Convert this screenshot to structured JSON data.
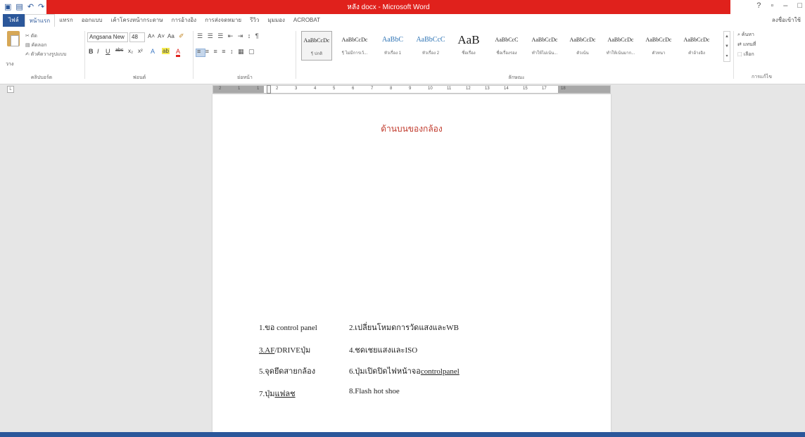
{
  "window": {
    "title": "หลัง docx - Microsoft Word",
    "controls": [
      "?",
      "▫",
      "–",
      "□"
    ]
  },
  "quick_access": [
    "▣",
    "▤",
    "↶",
    "↷"
  ],
  "tabs": [
    {
      "label": "ไฟล์",
      "kind": "file"
    },
    {
      "label": "หน้าแรก",
      "kind": "active"
    },
    {
      "label": "แทรก"
    },
    {
      "label": "ออกแบบ"
    },
    {
      "label": "เค้าโครงหน้ากระดาษ"
    },
    {
      "label": "การอ้างอิง"
    },
    {
      "label": "การส่งจดหมาย"
    },
    {
      "label": "รีวิว"
    },
    {
      "label": "มุมมอง"
    },
    {
      "label": "ACROBAT"
    }
  ],
  "account": "ลงชื่อเข้าใช้",
  "ribbon": {
    "clipboard": {
      "paste_label": "วาง",
      "cut": "✂ ตัด",
      "copy": "▤ คัดลอก",
      "format_painter": "✍ ตัวคัดวางรูปแบบ",
      "label": "คลิปบอร์ด"
    },
    "font": {
      "name": "Angsana New",
      "size": "48",
      "grow": "A˄",
      "shrink": "A˅",
      "case": "Aa",
      "clear": "✐",
      "bold": "B",
      "italic": "I",
      "underline": "U",
      "strike": "abc",
      "sub": "x₂",
      "sup": "x²",
      "effects": "A",
      "highlight": "ab",
      "color": "A",
      "label": "ฟอนต์"
    },
    "paragraph": {
      "row1": "☰ ☰ ☰ ⇤ ⇥ ↕ ¶",
      "row2": "≡ ≡ ≡ ≡ ↕ ▦ ▢",
      "label": "ย่อหน้า"
    },
    "styles": {
      "label": "ลักษณะ",
      "items": [
        {
          "sample": "AaBbCcDc",
          "name": "¶ ปกติ",
          "selected": true
        },
        {
          "sample": "AaBbCcDc",
          "name": "¶ ไม่มีการเว้..."
        },
        {
          "sample": "AaBbC",
          "name": "หัวเรื่อง 1"
        },
        {
          "sample": "AaBbCcC",
          "name": "หัวเรื่อง 2"
        },
        {
          "sample": "AaB",
          "name": "ชื่อเรื่อง"
        },
        {
          "sample": "AaBbCcC",
          "name": "ชื่อเรื่องรอง"
        },
        {
          "sample": "AaBbCcDc",
          "name": "ทำให้ไม่เน้น..."
        },
        {
          "sample": "AaBbCcDc",
          "name": "ตัวเน้น"
        },
        {
          "sample": "AaBbCcDc",
          "name": "ทำให้เน้นมาก..."
        },
        {
          "sample": "AaBbCcDc",
          "name": "ตัวหนา"
        },
        {
          "sample": "AaBbCcDc",
          "name": "คำอ้างอิง"
        }
      ]
    },
    "editing": {
      "find": "ค้นหา",
      "replace": "แทนที่",
      "select": "เลือก",
      "label": "การแก้ไข"
    }
  },
  "ruler": {
    "ticks": [
      "2",
      "1",
      "1",
      "2",
      "3",
      "4",
      "5",
      "6",
      "7",
      "8",
      "9",
      "10",
      "11",
      "12",
      "13",
      "14",
      "15",
      "17",
      "18"
    ]
  },
  "document": {
    "heading": "ด้านบนของกล้อง",
    "labels": [
      {
        "text": "1.ขอ control panel",
        "underline": false
      },
      {
        "text": "2.เปลี่ยนโหมดการวัดแสงและWB",
        "underline": false
      },
      {
        "pre": "",
        "u": "3.AF",
        "post": "/DRIVEปุ่ม"
      },
      {
        "text": "4.ชดเชยแสงและISO",
        "underline": false
      },
      {
        "text": "5.จุดยึดสายกล้อง",
        "underline": false
      },
      {
        "pre": "6.ปุ่มเปิดปิดไฟหน้าจอ",
        "u": "controlpanel",
        "post": ""
      },
      {
        "pre": "7.ปุ่ม",
        "u": "แฟลช",
        "post": ""
      },
      {
        "text": "8.Flash hot shoe",
        "underline": false
      }
    ]
  }
}
